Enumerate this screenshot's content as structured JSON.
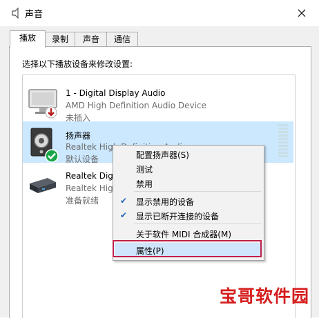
{
  "window": {
    "title": "声音",
    "title_icon": "speaker-icon",
    "close_icon": "close-icon"
  },
  "tabs": [
    {
      "label": "播放",
      "active": true
    },
    {
      "label": "录制",
      "active": false
    },
    {
      "label": "声音",
      "active": false
    },
    {
      "label": "通信",
      "active": false
    }
  ],
  "instruction": "选择以下播放设备来修改设置:",
  "devices": [
    {
      "name": "1 - Digital Display Audio",
      "description": "AMD High Definition Audio Device",
      "status": "未插入",
      "icon": "monitor-icon",
      "badge": "down-arrow-badge"
    },
    {
      "name": "扬声器",
      "description": "Realtek High Definition Audio",
      "status": "默认设备",
      "icon": "speaker-icon",
      "badge": "checkmark-badge",
      "selected": true
    },
    {
      "name": "Realtek Digit",
      "description": "Realtek Hig",
      "status": "准备就绪",
      "icon": "digital-output-icon"
    }
  ],
  "context_menu": {
    "items": [
      {
        "label": "配置扬声器(S)",
        "checked": false
      },
      {
        "label": "测试",
        "checked": false
      },
      {
        "label": "禁用",
        "checked": false
      },
      {
        "label": "显示禁用的设备",
        "checked": true
      },
      {
        "label": "显示已断开连接的设备",
        "checked": true
      },
      {
        "label": "关于软件 MIDI 合成器(M)",
        "checked": false
      },
      {
        "label": "属性(P)",
        "checked": false,
        "highlighted": true
      }
    ],
    "check_glyph": "✔"
  },
  "watermark": "宝哥软件园",
  "colors": {
    "selection": "#cce8ff",
    "menu_highlight": "#cfe5fb",
    "highlight_frame": "#c2214b",
    "watermark": "#d51d1d"
  }
}
